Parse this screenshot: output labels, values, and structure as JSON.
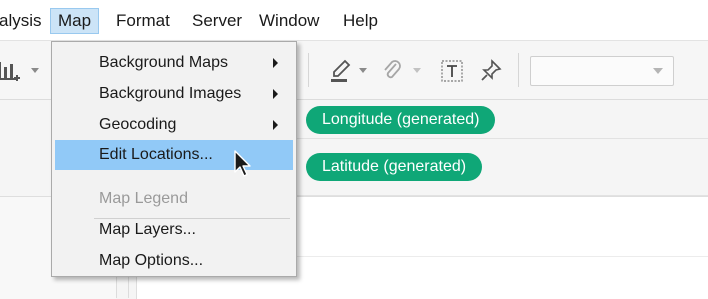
{
  "menubar": {
    "items": [
      {
        "label": "alysis"
      },
      {
        "label": "Map"
      },
      {
        "label": "Format"
      },
      {
        "label": "Server"
      },
      {
        "label": "Window"
      },
      {
        "label": "Help"
      }
    ],
    "active_index": 1
  },
  "map_menu": {
    "items": [
      {
        "label": "Background Maps",
        "submenu": true
      },
      {
        "label": "Background Images",
        "submenu": true
      },
      {
        "label": "Geocoding",
        "submenu": true
      },
      {
        "label": "Edit Locations...",
        "highlighted": true
      },
      {
        "label": "Map Legend",
        "disabled": true
      },
      {
        "label": "Map Layers..."
      },
      {
        "label": "Map Options..."
      }
    ]
  },
  "shelves": {
    "columns_pill": "Longitude (generated)",
    "rows_pill": "Latitude (generated)",
    "pill_color": "#0fa777"
  },
  "toolbar": {
    "icons": [
      "bar-chart-add-icon",
      "highlighter-icon",
      "paperclip-icon",
      "text-box-icon",
      "pin-icon"
    ],
    "dropdown_value": ""
  },
  "colors": {
    "menu_highlight": "#91c9f7",
    "menubar_active": "#cce4f7"
  }
}
